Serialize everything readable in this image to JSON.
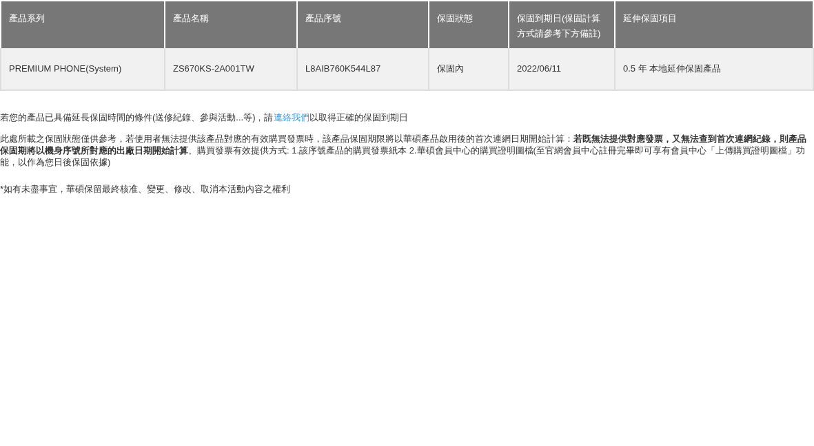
{
  "table": {
    "columns": [
      "產品系列",
      "產品名稱",
      "產品序號",
      "保固狀態",
      "保固到期日(保固計算方式請參考下方備註)",
      "延伸保固項目"
    ],
    "rows": [
      [
        "PREMIUM PHONE(System)",
        "ZS670KS-2A001TW",
        "L8AIB760K544L87",
        "保固內",
        "2022/06/11",
        "0.5 年 本地延伸保固產品"
      ]
    ]
  },
  "notes": {
    "contact_sentence": {
      "before": "若您的產品已具備延長保固時間的條件(送修紀錄、參與活動...等)，請",
      "link": "連絡我們",
      "after": "以取得正確的保固到期日"
    },
    "disclaimer": "此處所載之保固狀態僅供參考，若使用者無法提供該產品對應的有效購買發票時，該產品保固期限將以華碩產品啟用後的首次連網日期開始計算：**若既無法提供對應發票，又無法查到首次連網紀錄，則產品保固期將以機身序號所對應的出廠日期開始計算**。購買發票有效提供方式: 1.該序號產品的購買發票紙本 2.華碩會員中心的購買證明圖檔(至官網會員中心註冊完畢即可享有會員中心「上傳購買證明圖檔」功能，以作為您日後保固依據)",
    "footnote": "*如有未盡事宜，華碩保留最終核准、變更、修改、取消本活動內容之權利"
  }
}
